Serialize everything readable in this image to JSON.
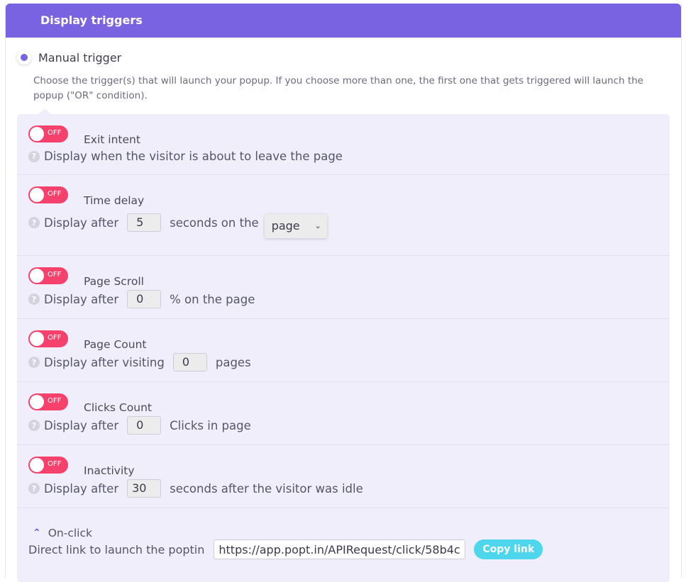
{
  "header": {
    "title": "Display triggers"
  },
  "manual": {
    "label": "Manual trigger",
    "description": "Choose the trigger(s) that will launch your popup. If you choose more than one, the first one that gets triggered will launch the popup (\"OR\" condition)."
  },
  "toggle_off_label": "OFF",
  "help_glyph": "?",
  "triggers": {
    "exit": {
      "title": "Exit intent",
      "text": "Display when the visitor is about to leave the page"
    },
    "time": {
      "title": "Time delay",
      "prefix": "Display after",
      "value": "5",
      "suffix": "seconds on the",
      "select_value": "page"
    },
    "scroll": {
      "title": "Page Scroll",
      "prefix": "Display after",
      "value": "0",
      "suffix": "% on the page"
    },
    "pagecount": {
      "title": "Page Count",
      "prefix": "Display after visiting",
      "value": "0",
      "suffix": "pages"
    },
    "clicks": {
      "title": "Clicks Count",
      "prefix": "Display after",
      "value": "0",
      "suffix": "Clicks in page"
    },
    "inactivity": {
      "title": "Inactivity",
      "prefix": "Display after",
      "value": "30",
      "suffix": "seconds after the visitor was idle"
    }
  },
  "onclick": {
    "title": "On-click",
    "label": "Direct link to launch the poptin",
    "link": "https://app.popt.in/APIRequest/click/58b4c",
    "copy_label": "Copy link"
  },
  "colors": {
    "accent": "#7a63e0",
    "toggle_off": "#f5416c",
    "copy": "#4ed6ec",
    "panel_bg": "#f1eefb"
  },
  "icons": {
    "help": "question-circle-icon",
    "chevron": "chevron-up-icon",
    "select_arrow": "chevron-down-icon"
  }
}
